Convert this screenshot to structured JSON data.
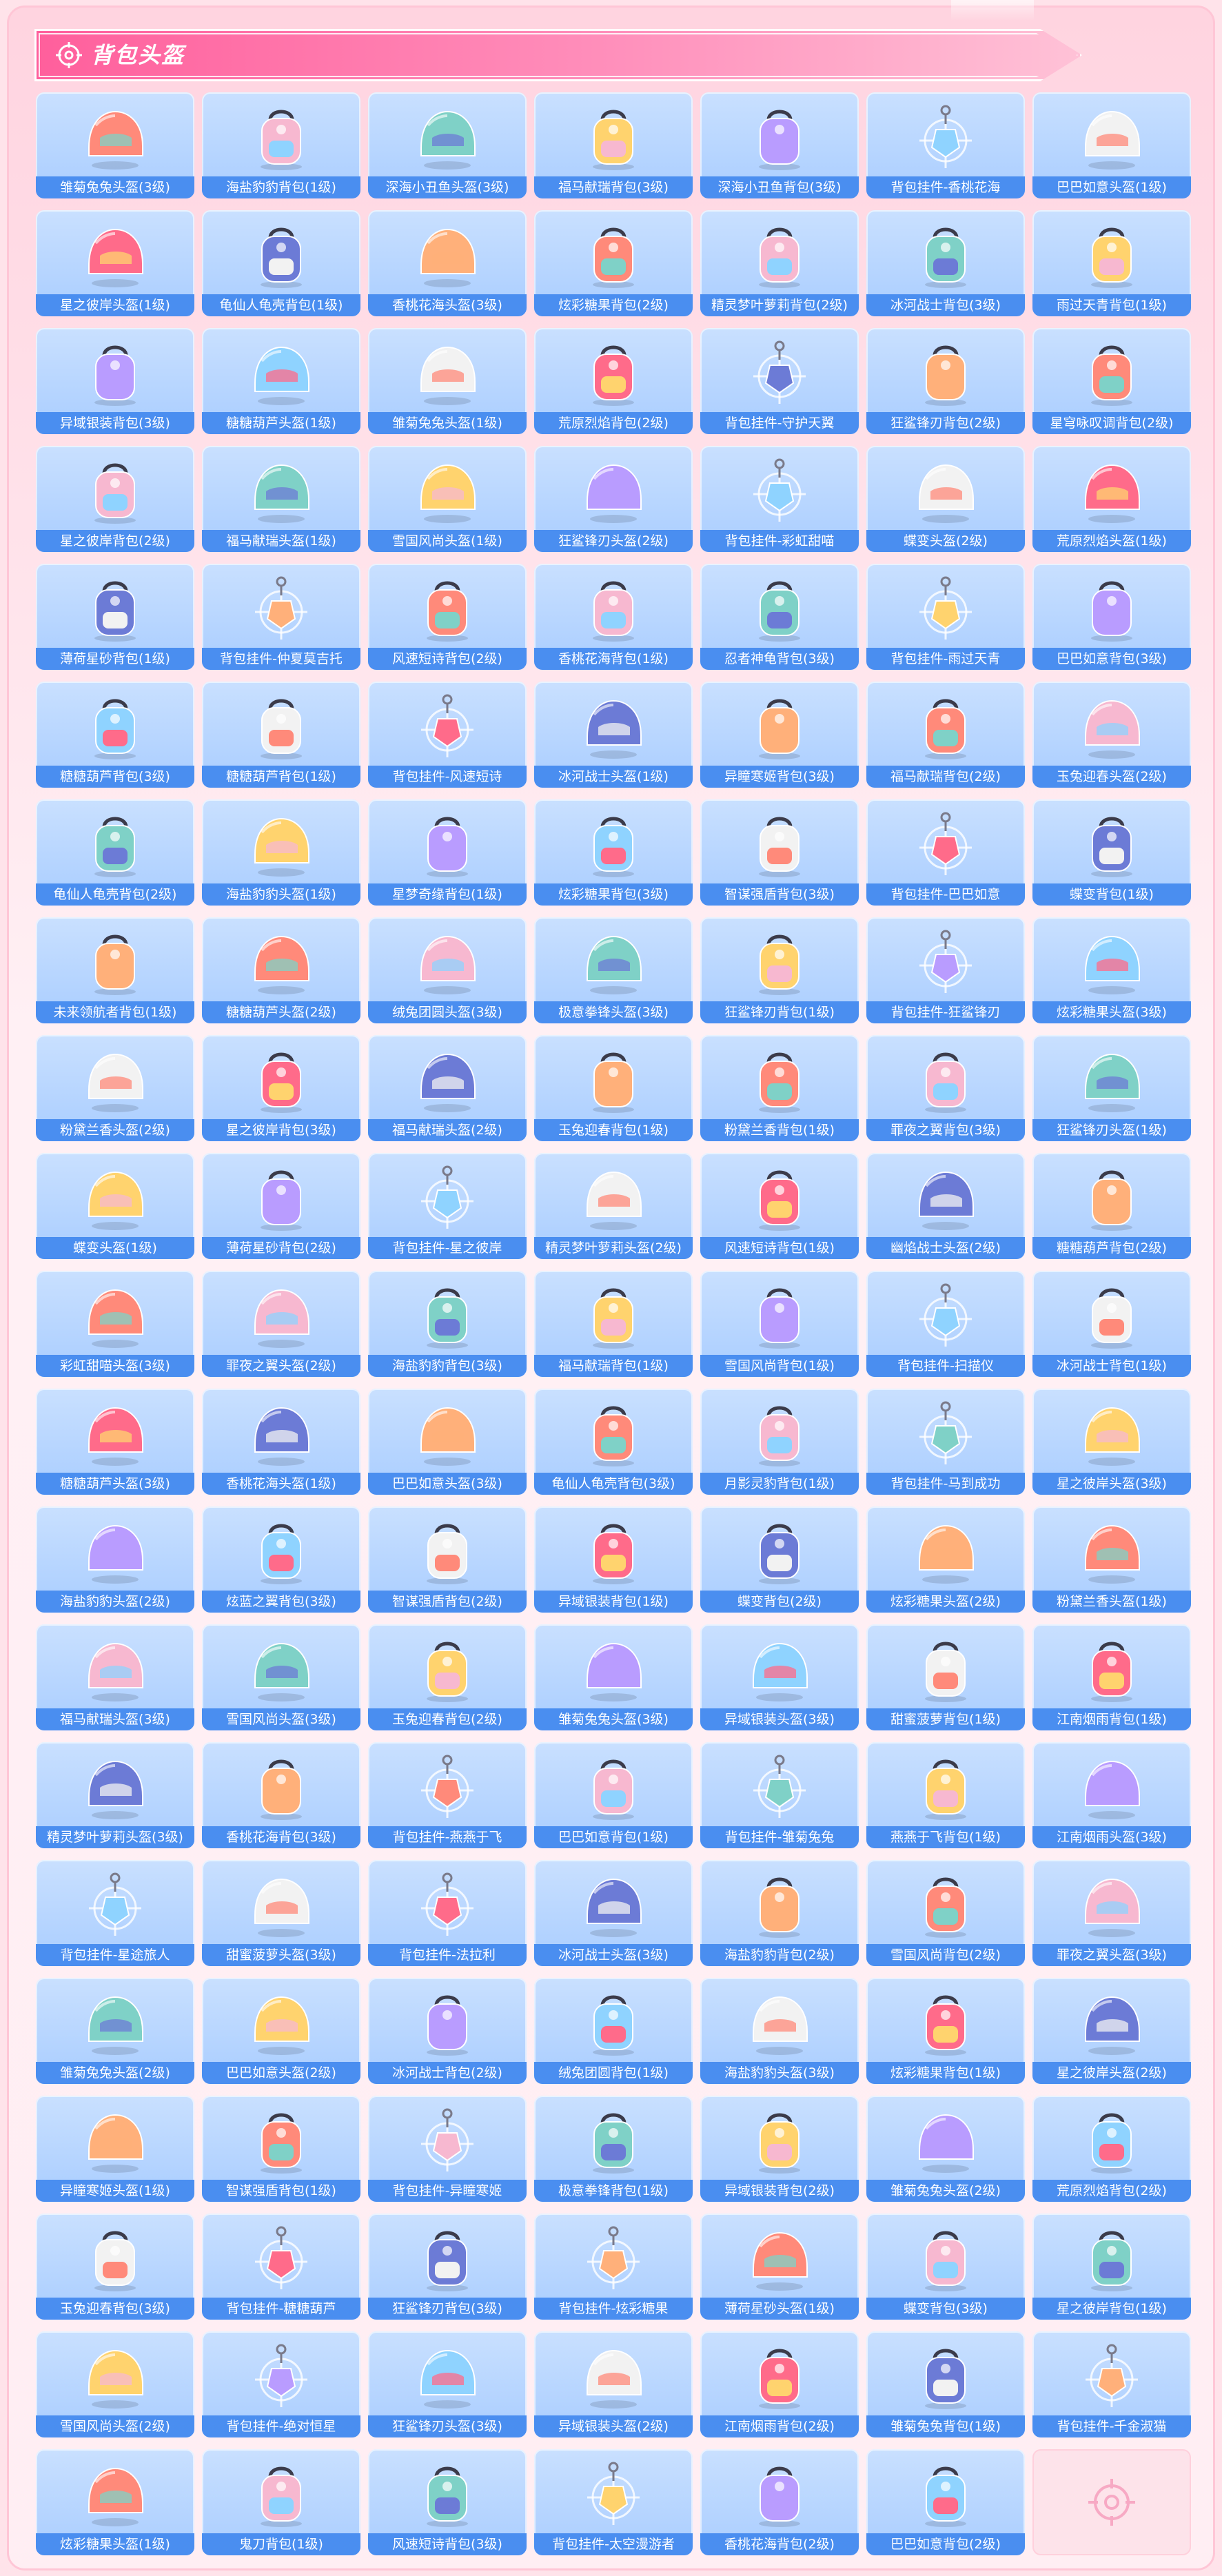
{
  "header": {
    "title": "背包头盔"
  },
  "colors": {
    "header_pink": "#ff5f9c",
    "tile_bg": "#a9cdff",
    "label_blue": "#4a8ef0",
    "icon_pink": "#f7a9c4"
  },
  "items": [
    {
      "label": "雏菊兔兔头盔(3级)",
      "type": "helmet"
    },
    {
      "label": "海盐豹豹背包(1级)",
      "type": "backpack"
    },
    {
      "label": "深海小丑鱼头盔(3级)",
      "type": "helmet"
    },
    {
      "label": "福马献瑞背包(3级)",
      "type": "backpack"
    },
    {
      "label": "深海小丑鱼背包(3级)",
      "type": "backpack"
    },
    {
      "label": "背包挂件-香桃花海",
      "type": "charm"
    },
    {
      "label": "巴巴如意头盔(1级)",
      "type": "helmet"
    },
    {
      "label": "星之彼岸头盔(1级)",
      "type": "helmet"
    },
    {
      "label": "龟仙人龟壳背包(1级)",
      "type": "backpack"
    },
    {
      "label": "香桃花海头盔(3级)",
      "type": "helmet"
    },
    {
      "label": "炫彩糖果背包(2级)",
      "type": "backpack"
    },
    {
      "label": "精灵梦叶萝莉背包(2级)",
      "type": "backpack"
    },
    {
      "label": "冰河战士背包(3级)",
      "type": "backpack"
    },
    {
      "label": "雨过天青背包(1级)",
      "type": "backpack"
    },
    {
      "label": "异域银装背包(3级)",
      "type": "backpack"
    },
    {
      "label": "糖糖葫芦头盔(1级)",
      "type": "helmet"
    },
    {
      "label": "雏菊兔兔头盔(1级)",
      "type": "helmet"
    },
    {
      "label": "荒原烈焰背包(2级)",
      "type": "backpack"
    },
    {
      "label": "背包挂件-守护天翼",
      "type": "charm"
    },
    {
      "label": "狂鲨锋刃背包(2级)",
      "type": "backpack"
    },
    {
      "label": "星穹咏叹调背包(2级)",
      "type": "backpack"
    },
    {
      "label": "星之彼岸背包(2级)",
      "type": "backpack"
    },
    {
      "label": "福马献瑞头盔(1级)",
      "type": "helmet"
    },
    {
      "label": "雪国风尚头盔(1级)",
      "type": "helmet"
    },
    {
      "label": "狂鲨锋刃头盔(2级)",
      "type": "helmet"
    },
    {
      "label": "背包挂件-彩虹甜喵",
      "type": "charm"
    },
    {
      "label": "蝶变头盔(2级)",
      "type": "helmet"
    },
    {
      "label": "荒原烈焰头盔(1级)",
      "type": "helmet"
    },
    {
      "label": "薄荷星砂背包(1级)",
      "type": "backpack"
    },
    {
      "label": "背包挂件-仲夏莫吉托",
      "type": "charm"
    },
    {
      "label": "风速短诗背包(2级)",
      "type": "backpack"
    },
    {
      "label": "香桃花海背包(1级)",
      "type": "backpack"
    },
    {
      "label": "忍者神龟背包(3级)",
      "type": "backpack"
    },
    {
      "label": "背包挂件-雨过天青",
      "type": "charm"
    },
    {
      "label": "巴巴如意背包(3级)",
      "type": "backpack"
    },
    {
      "label": "糖糖葫芦背包(3级)",
      "type": "backpack"
    },
    {
      "label": "糖糖葫芦背包(1级)",
      "type": "backpack"
    },
    {
      "label": "背包挂件-风速短诗",
      "type": "charm"
    },
    {
      "label": "冰河战士头盔(1级)",
      "type": "helmet"
    },
    {
      "label": "异瞳寒姬背包(3级)",
      "type": "backpack"
    },
    {
      "label": "福马献瑞背包(2级)",
      "type": "backpack"
    },
    {
      "label": "玉兔迎春头盔(2级)",
      "type": "helmet"
    },
    {
      "label": "龟仙人龟壳背包(2级)",
      "type": "backpack"
    },
    {
      "label": "海盐豹豹头盔(1级)",
      "type": "helmet"
    },
    {
      "label": "星梦奇缘背包(1级)",
      "type": "backpack"
    },
    {
      "label": "炫彩糖果背包(3级)",
      "type": "backpack"
    },
    {
      "label": "智谋强盾背包(3级)",
      "type": "backpack"
    },
    {
      "label": "背包挂件-巴巴如意",
      "type": "charm"
    },
    {
      "label": "蝶变背包(1级)",
      "type": "backpack"
    },
    {
      "label": "未来领航者背包(1级)",
      "type": "backpack"
    },
    {
      "label": "糖糖葫芦头盔(2级)",
      "type": "helmet"
    },
    {
      "label": "绒兔团圆头盔(3级)",
      "type": "helmet"
    },
    {
      "label": "极意拳锋头盔(3级)",
      "type": "helmet"
    },
    {
      "label": "狂鲨锋刃背包(1级)",
      "type": "backpack"
    },
    {
      "label": "背包挂件-狂鲨锋刃",
      "type": "charm"
    },
    {
      "label": "炫彩糖果头盔(3级)",
      "type": "helmet"
    },
    {
      "label": "粉黛兰香头盔(2级)",
      "type": "helmet"
    },
    {
      "label": "星之彼岸背包(3级)",
      "type": "backpack"
    },
    {
      "label": "福马献瑞头盔(2级)",
      "type": "helmet"
    },
    {
      "label": "玉兔迎春背包(1级)",
      "type": "backpack"
    },
    {
      "label": "粉黛兰香背包(1级)",
      "type": "backpack"
    },
    {
      "label": "罪夜之翼背包(3级)",
      "type": "backpack"
    },
    {
      "label": "狂鲨锋刃头盔(1级)",
      "type": "helmet"
    },
    {
      "label": "蝶变头盔(1级)",
      "type": "helmet"
    },
    {
      "label": "薄荷星砂背包(2级)",
      "type": "backpack"
    },
    {
      "label": "背包挂件-星之彼岸",
      "type": "charm"
    },
    {
      "label": "精灵梦叶萝莉头盔(2级)",
      "type": "helmet"
    },
    {
      "label": "风速短诗背包(1级)",
      "type": "backpack"
    },
    {
      "label": "幽焰战士头盔(2级)",
      "type": "helmet"
    },
    {
      "label": "糖糖葫芦背包(2级)",
      "type": "backpack"
    },
    {
      "label": "彩虹甜喵头盔(3级)",
      "type": "helmet"
    },
    {
      "label": "罪夜之翼头盔(2级)",
      "type": "helmet"
    },
    {
      "label": "海盐豹豹背包(3级)",
      "type": "backpack"
    },
    {
      "label": "福马献瑞背包(1级)",
      "type": "backpack"
    },
    {
      "label": "雪国风尚背包(1级)",
      "type": "backpack"
    },
    {
      "label": "背包挂件-扫描仪",
      "type": "charm"
    },
    {
      "label": "冰河战士背包(1级)",
      "type": "backpack"
    },
    {
      "label": "糖糖葫芦头盔(3级)",
      "type": "helmet"
    },
    {
      "label": "香桃花海头盔(1级)",
      "type": "helmet"
    },
    {
      "label": "巴巴如意头盔(3级)",
      "type": "helmet"
    },
    {
      "label": "龟仙人龟壳背包(3级)",
      "type": "backpack"
    },
    {
      "label": "月影灵豹背包(1级)",
      "type": "backpack"
    },
    {
      "label": "背包挂件-马到成功",
      "type": "charm"
    },
    {
      "label": "星之彼岸头盔(3级)",
      "type": "helmet"
    },
    {
      "label": "海盐豹豹头盔(2级)",
      "type": "helmet"
    },
    {
      "label": "炫蓝之翼背包(3级)",
      "type": "backpack"
    },
    {
      "label": "智谋强盾背包(2级)",
      "type": "backpack"
    },
    {
      "label": "异域银装背包(1级)",
      "type": "backpack"
    },
    {
      "label": "蝶变背包(2级)",
      "type": "backpack"
    },
    {
      "label": "炫彩糖果头盔(2级)",
      "type": "helmet"
    },
    {
      "label": "粉黛兰香头盔(1级)",
      "type": "helmet"
    },
    {
      "label": "福马献瑞头盔(3级)",
      "type": "helmet"
    },
    {
      "label": "雪国风尚头盔(3级)",
      "type": "helmet"
    },
    {
      "label": "玉兔迎春背包(2级)",
      "type": "backpack"
    },
    {
      "label": "雏菊兔兔头盔(3级)",
      "type": "helmet"
    },
    {
      "label": "异域银装头盔(3级)",
      "type": "helmet"
    },
    {
      "label": "甜蜜菠萝背包(1级)",
      "type": "backpack"
    },
    {
      "label": "江南烟雨背包(1级)",
      "type": "backpack"
    },
    {
      "label": "精灵梦叶萝莉头盔(3级)",
      "type": "helmet"
    },
    {
      "label": "香桃花海背包(3级)",
      "type": "backpack"
    },
    {
      "label": "背包挂件-燕燕于飞",
      "type": "charm"
    },
    {
      "label": "巴巴如意背包(1级)",
      "type": "backpack"
    },
    {
      "label": "背包挂件-雏菊兔兔",
      "type": "charm"
    },
    {
      "label": "燕燕于飞背包(1级)",
      "type": "backpack"
    },
    {
      "label": "江南烟雨头盔(3级)",
      "type": "helmet"
    },
    {
      "label": "背包挂件-星途旅人",
      "type": "charm"
    },
    {
      "label": "甜蜜菠萝头盔(3级)",
      "type": "helmet"
    },
    {
      "label": "背包挂件-法拉利",
      "type": "charm"
    },
    {
      "label": "冰河战士头盔(3级)",
      "type": "helmet"
    },
    {
      "label": "海盐豹豹背包(2级)",
      "type": "backpack"
    },
    {
      "label": "雪国风尚背包(2级)",
      "type": "backpack"
    },
    {
      "label": "罪夜之翼头盔(3级)",
      "type": "helmet"
    },
    {
      "label": "雏菊兔兔头盔(2级)",
      "type": "helmet"
    },
    {
      "label": "巴巴如意头盔(2级)",
      "type": "helmet"
    },
    {
      "label": "冰河战士背包(2级)",
      "type": "backpack"
    },
    {
      "label": "绒兔团圆背包(1级)",
      "type": "backpack"
    },
    {
      "label": "海盐豹豹头盔(3级)",
      "type": "helmet"
    },
    {
      "label": "炫彩糖果背包(1级)",
      "type": "backpack"
    },
    {
      "label": "星之彼岸头盔(2级)",
      "type": "helmet"
    },
    {
      "label": "异瞳寒姬头盔(1级)",
      "type": "helmet"
    },
    {
      "label": "智谋强盾背包(1级)",
      "type": "backpack"
    },
    {
      "label": "背包挂件-异瞳寒姬",
      "type": "charm"
    },
    {
      "label": "极意拳锋背包(1级)",
      "type": "backpack"
    },
    {
      "label": "异域银装背包(2级)",
      "type": "backpack"
    },
    {
      "label": "雏菊兔兔头盔(2级)",
      "type": "helmet"
    },
    {
      "label": "荒原烈焰背包(2级)",
      "type": "backpack"
    },
    {
      "label": "玉兔迎春背包(3级)",
      "type": "backpack"
    },
    {
      "label": "背包挂件-糖糖葫芦",
      "type": "charm"
    },
    {
      "label": "狂鲨锋刃背包(3级)",
      "type": "backpack"
    },
    {
      "label": "背包挂件-炫彩糖果",
      "type": "charm"
    },
    {
      "label": "薄荷星砂头盔(1级)",
      "type": "helmet"
    },
    {
      "label": "蝶变背包(3级)",
      "type": "backpack"
    },
    {
      "label": "星之彼岸背包(1级)",
      "type": "backpack"
    },
    {
      "label": "雪国风尚头盔(2级)",
      "type": "helmet"
    },
    {
      "label": "背包挂件-绝对恒星",
      "type": "charm"
    },
    {
      "label": "狂鲨锋刃头盔(3级)",
      "type": "helmet"
    },
    {
      "label": "异域银装头盔(2级)",
      "type": "helmet"
    },
    {
      "label": "江南烟雨背包(2级)",
      "type": "backpack"
    },
    {
      "label": "雏菊兔兔背包(1级)",
      "type": "backpack"
    },
    {
      "label": "背包挂件-千金淑猫",
      "type": "charm"
    },
    {
      "label": "炫彩糖果头盔(1级)",
      "type": "helmet"
    },
    {
      "label": "鬼刀背包(1级)",
      "type": "backpack"
    },
    {
      "label": "风速短诗背包(3级)",
      "type": "backpack"
    },
    {
      "label": "背包挂件-太空漫游者",
      "type": "charm"
    },
    {
      "label": "香桃花海背包(2级)",
      "type": "backpack"
    },
    {
      "label": "巴巴如意背包(2级)",
      "type": "backpack"
    }
  ],
  "icon_names": {
    "header": "crosshair-icon",
    "empty_slot": "crosshair-icon"
  }
}
